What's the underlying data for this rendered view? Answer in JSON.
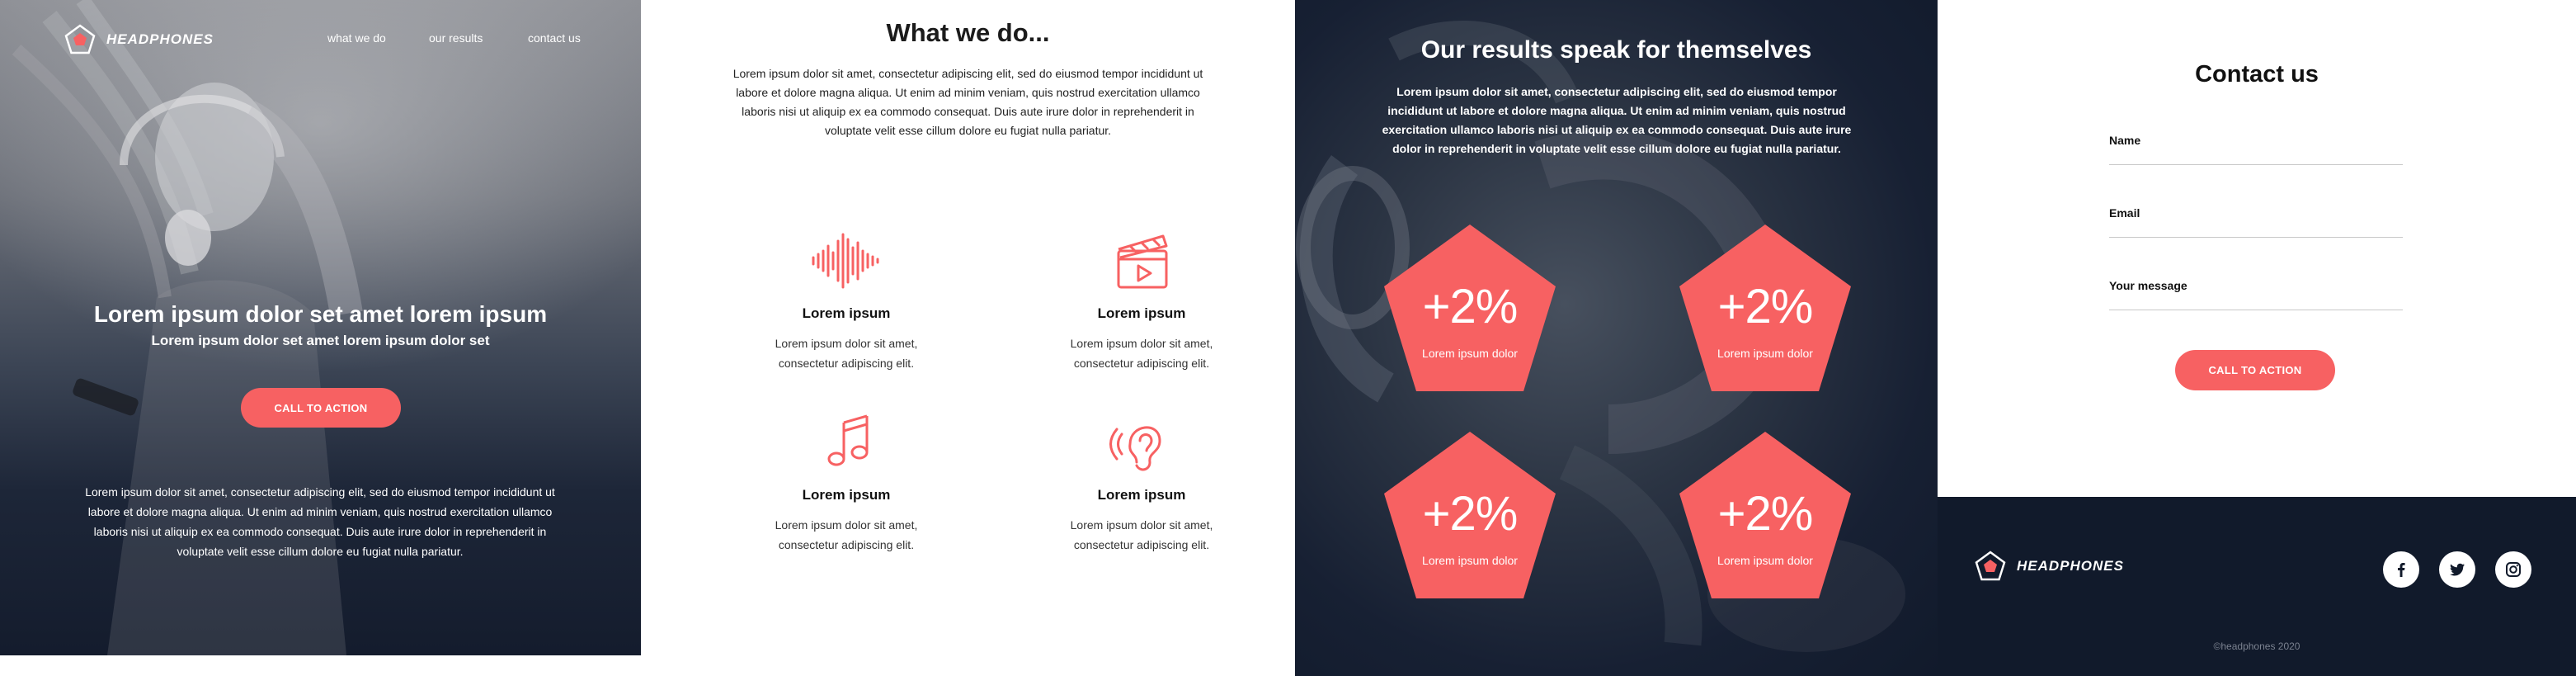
{
  "colors": {
    "accent": "#f76162",
    "dark_navy": "#111a2b",
    "white": "#ffffff"
  },
  "brand": {
    "name": "HEADPHONES",
    "logo_icon": "pentagon-logo-icon"
  },
  "hero": {
    "nav": [
      "what we do",
      "our results",
      "contact us"
    ],
    "title": "Lorem ipsum dolor set amet lorem ipsum",
    "subtitle": "Lorem ipsum dolor set amet lorem ipsum dolor set",
    "cta": "CALL TO ACTION",
    "body": "Lorem ipsum dolor sit amet, consectetur adipiscing elit, sed do eiusmod tempor incididunt ut labore et dolore magna aliqua. Ut enim ad minim veniam, quis nostrud exercitation ullamco laboris nisi ut aliquip ex ea commodo consequat. Duis aute irure dolor in reprehenderit in voluptate velit esse cillum dolore eu fugiat nulla pariatur."
  },
  "services": {
    "title": "What we do...",
    "body": "Lorem ipsum dolor sit amet, consectetur adipiscing elit, sed do eiusmod tempor incididunt ut labore et dolore magna aliqua. Ut enim ad minim veniam, quis nostrud exercitation ullamco laboris nisi ut aliquip ex ea commodo consequat. Duis aute irure dolor in reprehenderit in voluptate velit esse cillum dolore eu fugiat nulla pariatur.",
    "items": [
      {
        "icon": "sound-wave-icon",
        "title": "Lorem ipsum",
        "text": "Lorem ipsum dolor sit amet, consectetur adipiscing elit."
      },
      {
        "icon": "clapperboard-icon",
        "title": "Lorem ipsum",
        "text": "Lorem ipsum dolor sit amet, consectetur adipiscing elit."
      },
      {
        "icon": "music-note-icon",
        "title": "Lorem ipsum",
        "text": "Lorem ipsum dolor sit amet, consectetur adipiscing elit."
      },
      {
        "icon": "ear-sound-icon",
        "title": "Lorem ipsum",
        "text": "Lorem ipsum dolor sit amet, consectetur adipiscing elit."
      }
    ]
  },
  "results": {
    "title": "Our results speak for themselves",
    "body": "Lorem ipsum dolor sit amet, consectetur adipiscing elit, sed do eiusmod tempor incididunt ut labore et dolore magna aliqua. Ut enim ad minim veniam, quis nostrud exercitation ullamco laboris nisi ut aliquip ex ea commodo consequat. Duis aute irure dolor in reprehenderit in voluptate velit esse cillum dolore eu fugiat nulla pariatur.",
    "stats": [
      {
        "value": "+2%",
        "label": "Lorem ipsum dolor"
      },
      {
        "value": "+2%",
        "label": "Lorem ipsum dolor"
      },
      {
        "value": "+2%",
        "label": "Lorem ipsum dolor"
      },
      {
        "value": "+2%",
        "label": "Lorem ipsum dolor"
      }
    ]
  },
  "contact": {
    "title": "Contact us",
    "fields": [
      {
        "label": "Name",
        "value": ""
      },
      {
        "label": "Email",
        "value": ""
      },
      {
        "label": "Your message",
        "value": ""
      }
    ],
    "cta": "CALL TO ACTION"
  },
  "footer": {
    "social": [
      "facebook-icon",
      "twitter-icon",
      "instagram-icon"
    ],
    "copyright": "©headphones 2020"
  }
}
